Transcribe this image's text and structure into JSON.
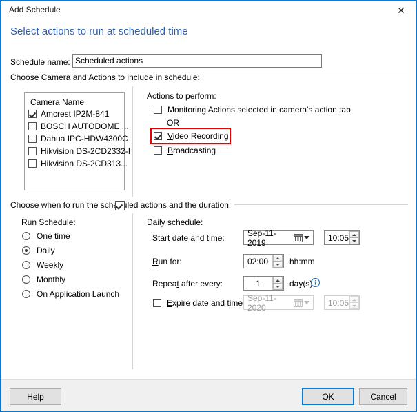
{
  "window": {
    "title": "Add Schedule",
    "close_icon": "close-icon",
    "heading": "Select actions to run at scheduled time"
  },
  "schedule_name": {
    "label": "Schedule name:",
    "value": "Scheduled actions"
  },
  "group_camera": {
    "label": "Choose Camera and Actions to include in schedule:"
  },
  "camera_list": {
    "header": "Camera Name",
    "items": [
      {
        "label": "Amcrest IP2M-841",
        "checked": true
      },
      {
        "label": "BOSCH AUTODOME ...",
        "checked": false
      },
      {
        "label": "Dahua IPC-HDW4300C",
        "checked": false
      },
      {
        "label": "Hikvision DS-2CD2332-I",
        "checked": false
      },
      {
        "label": "Hikvision DS-2CD313...",
        "checked": false
      }
    ]
  },
  "actions": {
    "header": "Actions to perform:",
    "or_text": "OR",
    "items": [
      {
        "label": "Monitoring Actions selected in camera's action tab",
        "checked": false,
        "accel": ""
      },
      {
        "label": "Video Recording",
        "checked": true,
        "accel": "V",
        "highlighted": true
      },
      {
        "label": "Broadcasting",
        "checked": false,
        "accel": "B"
      }
    ],
    "highlight_color": "#e80000"
  },
  "group_schedule": {
    "label": "Choose when to run the scheduled actions and the duration:"
  },
  "run_schedule": {
    "header": "Run Schedule:",
    "options": [
      {
        "label": "One time",
        "selected": false
      },
      {
        "label": "Daily",
        "selected": true
      },
      {
        "label": "Weekly",
        "selected": false
      },
      {
        "label": "Monthly",
        "selected": false
      },
      {
        "label": "On Application Launch",
        "selected": false
      }
    ]
  },
  "daily_schedule": {
    "header": "Daily schedule:",
    "start": {
      "label": "Start date and time:",
      "accel": "d",
      "date": "Sep-11-2019",
      "time": "10:05",
      "calendar_icon": "calendar-icon",
      "dropdown_icon": "chevron-down-icon"
    },
    "run_for": {
      "label": "Run for:",
      "accel": "R",
      "value": "02:00",
      "unit": "hh:mm"
    },
    "repeat": {
      "label": "Repeat after every:",
      "accel": "t",
      "value": "1",
      "unit": "day(s)",
      "info_icon": "info-icon"
    },
    "expire": {
      "label": "Expire date and time:",
      "accel": "E",
      "checked": false,
      "date": "Sep-11-2020",
      "time": "10:05",
      "calendar_icon": "calendar-icon",
      "dropdown_icon": "chevron-down-icon"
    }
  },
  "footer": {
    "help": "Help",
    "ok": "OK",
    "cancel": "Cancel"
  }
}
